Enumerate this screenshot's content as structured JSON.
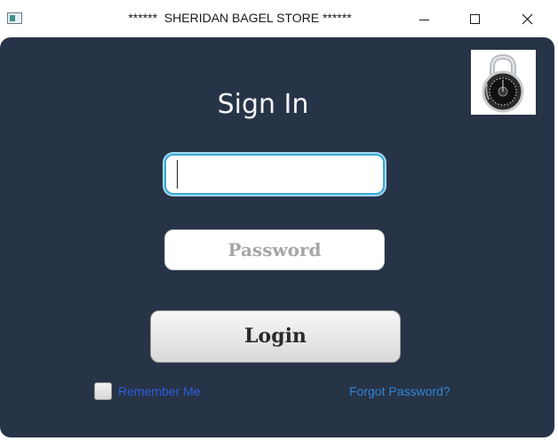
{
  "window": {
    "title": "******  SHERIDAN BAGEL STORE ******",
    "icons": {
      "app": "app-window-icon",
      "minimize": "minimize-icon",
      "maximize": "maximize-icon",
      "close": "close-icon"
    }
  },
  "panel": {
    "background": "#273346",
    "image": "padlock-icon"
  },
  "form": {
    "heading": "Sign In",
    "username": {
      "value": "",
      "placeholder": ""
    },
    "password": {
      "value": "",
      "placeholder": "Password"
    },
    "login_label": "Login",
    "remember_label": "Remember Me",
    "remember_checked": false,
    "forgot_label": "Forgot Password?"
  },
  "colors": {
    "focus_border": "#3aa8d8",
    "remember_link": "#2c5fe0",
    "forgot_link": "#2f86d6"
  }
}
